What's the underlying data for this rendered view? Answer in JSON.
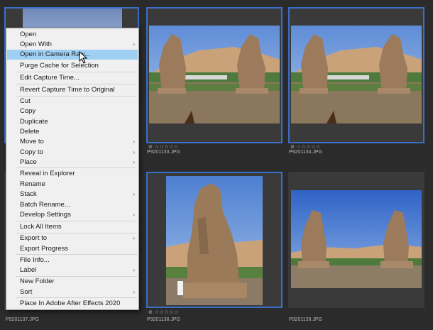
{
  "grid": {
    "cells": [
      {
        "caption": "",
        "stars": "",
        "selected": true
      },
      {
        "caption": "P9201133.JPG",
        "stars": "⊘ ☆☆☆☆☆",
        "selected": true
      },
      {
        "caption": "P9201134.JPG",
        "stars": "⊘ ☆☆☆☆☆",
        "selected": true
      },
      {
        "caption": "P9201137.JPG",
        "stars": "",
        "selected": false
      },
      {
        "caption": "P9201138.JPG",
        "stars": "⊘ ☆☆☆☆☆",
        "selected": true
      },
      {
        "caption": "P9201139.JPG",
        "stars": "",
        "selected": false
      }
    ]
  },
  "context_menu": {
    "items": [
      {
        "label": "Open",
        "submenu": false
      },
      {
        "label": "Open With",
        "submenu": true
      },
      {
        "label": "Open in Camera Raw...",
        "submenu": false,
        "highlighted": true
      },
      {
        "label": "Purge Cache for Selection",
        "submenu": false
      },
      {
        "label": "Edit Capture Time...",
        "submenu": false
      },
      {
        "label": "Revert Capture Time to Original",
        "submenu": false
      },
      {
        "label": "Cut",
        "submenu": false
      },
      {
        "label": "Copy",
        "submenu": false
      },
      {
        "label": "Duplicate",
        "submenu": false
      },
      {
        "label": "Delete",
        "submenu": false
      },
      {
        "label": "Move to",
        "submenu": true
      },
      {
        "label": "Copy to",
        "submenu": true
      },
      {
        "label": "Place",
        "submenu": true
      },
      {
        "label": "Reveal in Explorer",
        "submenu": false
      },
      {
        "label": "Rename",
        "submenu": false
      },
      {
        "label": "Stack",
        "submenu": true
      },
      {
        "label": "Batch Rename...",
        "submenu": false
      },
      {
        "label": "Develop Settings",
        "submenu": true
      },
      {
        "label": "Lock All Items",
        "submenu": false
      },
      {
        "label": "Export to",
        "submenu": true
      },
      {
        "label": "Export Progress",
        "submenu": false
      },
      {
        "label": "File Info...",
        "submenu": false
      },
      {
        "label": "Label",
        "submenu": true
      },
      {
        "label": "New Folder",
        "submenu": false
      },
      {
        "label": "Sort",
        "submenu": true
      },
      {
        "label": "Place In Adobe After Effects 2020",
        "submenu": false
      }
    ],
    "submenu_arrow": "›"
  },
  "colors": {
    "selection_border": "#3a6fc7",
    "menu_highlight": "#9fd0f4",
    "menu_bg": "#f0f0f0"
  }
}
